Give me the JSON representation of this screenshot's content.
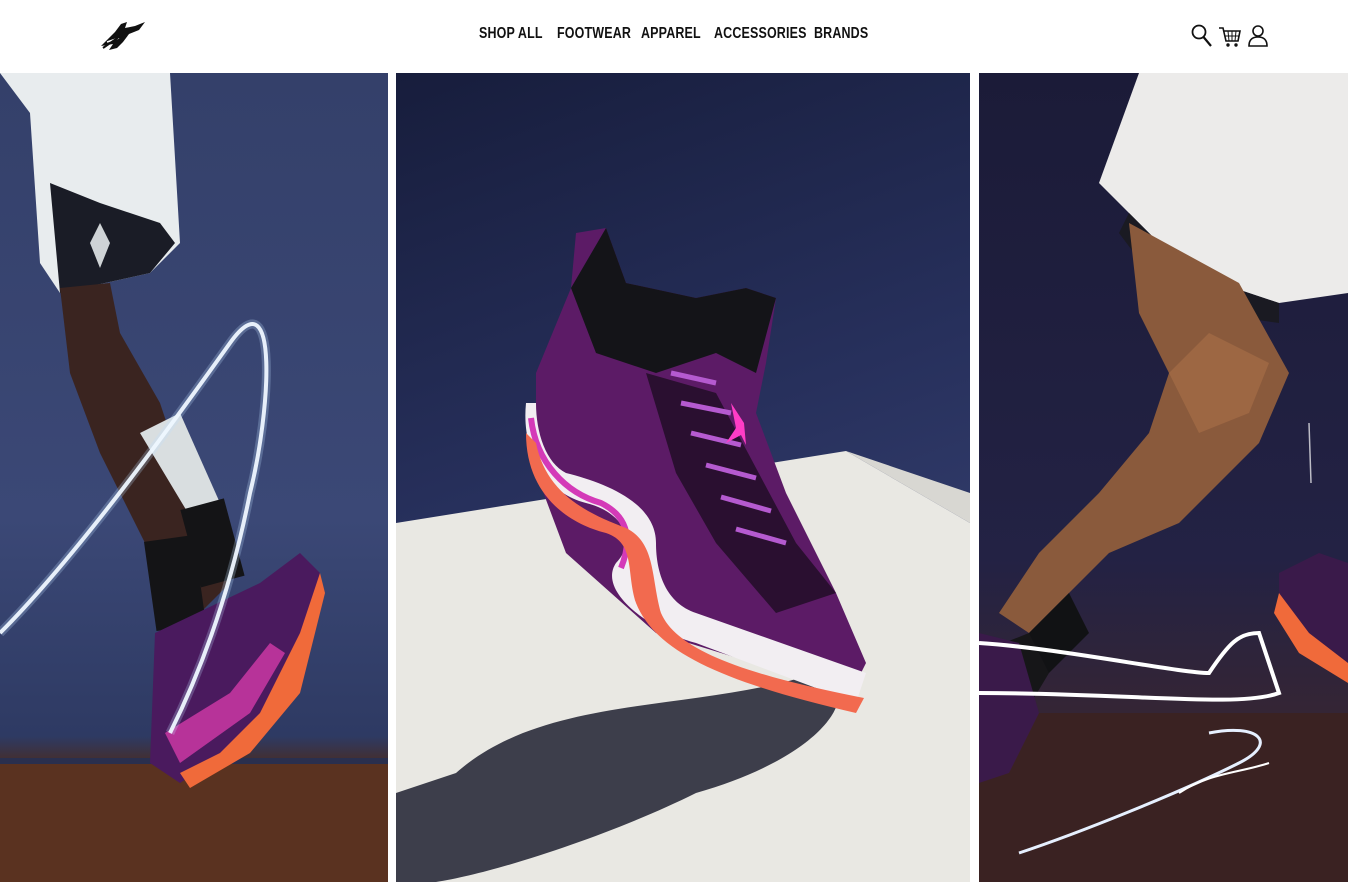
{
  "header": {
    "logo_icon": "jumpman-winged-logo",
    "nav": {
      "shop_all": "SHOP ALL",
      "footwear": "FOOTWEAR",
      "apparel": "APPAREL",
      "accessories": "ACCESSORIES",
      "brands": "BRANDS"
    },
    "icons": [
      "search-icon",
      "cart-icon",
      "account-icon"
    ]
  },
  "hero": {
    "panels": [
      {
        "image": "athlete-jumping-with-light-trail"
      },
      {
        "image": "basketball-shoe-on-pedestal"
      },
      {
        "image": "athlete-leg-with-light-trail"
      }
    ],
    "colors": {
      "accent_pink": "#d63aa8",
      "accent_purple": "#6a1f7a",
      "sole_orange": "#f0643c",
      "backdrop_navy": "#27305c"
    }
  }
}
